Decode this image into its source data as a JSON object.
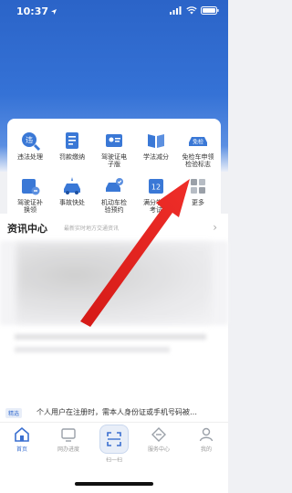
{
  "status_bar": {
    "time": "10:37"
  },
  "services": [
    {
      "label": "违法处理",
      "icon": "violation-icon",
      "icon_text": "违"
    },
    {
      "label": "罚款缴纳",
      "icon": "fine-payment-icon"
    },
    {
      "label": "驾驶证电子版",
      "icon": "license-e-icon"
    },
    {
      "label": "学法减分",
      "icon": "study-book-icon"
    },
    {
      "label": "免检车申领检验标志",
      "icon": "exempt-car-icon",
      "icon_text": "免检"
    },
    {
      "label": "驾驶证补换领",
      "icon": "license-replace-icon"
    },
    {
      "label": "事故快处",
      "icon": "accident-car-icon"
    },
    {
      "label": "机动车检验预约",
      "icon": "inspection-icon"
    },
    {
      "label": "满分学习考试",
      "icon": "full-score-icon",
      "icon_text": "12"
    },
    {
      "label": "更多",
      "icon": "more-grid-icon"
    }
  ],
  "service_label_lines": [
    [
      "违法处理"
    ],
    [
      "罚款缴纳"
    ],
    [
      "驾驶证电",
      "子版"
    ],
    [
      "学法减分"
    ],
    [
      "免检车申领",
      "检验标志"
    ],
    [
      "驾驶证补",
      "换领"
    ],
    [
      "事故快处"
    ],
    [
      "机动车检",
      "验预约"
    ],
    [
      "满分学习",
      "考试"
    ],
    [
      "更多"
    ]
  ],
  "news": {
    "title": "资讯中心",
    "subtitle": "最新实时地方交通资讯",
    "chevron": "›"
  },
  "notice": {
    "badge": "精选",
    "text": "个人用户在注册时，需本人身份证或手机号码被…"
  },
  "tabs": [
    {
      "label": "首页",
      "icon": "home-icon",
      "active": true
    },
    {
      "label": "网办进度",
      "icon": "progress-monitor-icon",
      "active": false
    },
    {
      "label": "扫一扫",
      "icon": "scan-icon",
      "active": false
    },
    {
      "label": "服务中心",
      "icon": "service-center-icon",
      "active": false
    },
    {
      "label": "我的",
      "icon": "profile-icon",
      "active": false
    }
  ],
  "colors": {
    "brand": "#2b64c8",
    "accent": "#3a6fd0",
    "arrow": "#e8231f"
  }
}
